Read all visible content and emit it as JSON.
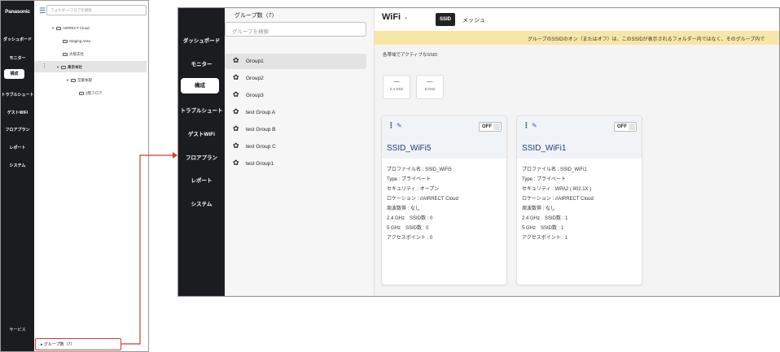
{
  "left_panel": {
    "brand": "Panasonic",
    "nav": [
      "ダッシュボード",
      "モニター",
      "構成",
      "トラブルシュート",
      "ゲストWiFi",
      "フロアプラン",
      "レポート",
      "システム"
    ],
    "active_nav": "構成",
    "search_placeholder": "フォルダー/フロアを検索",
    "tree": [
      {
        "label": "AIRRECT Cloud",
        "level": 0
      },
      {
        "label": "Staging Area",
        "level": 1
      },
      {
        "label": "大阪支社",
        "level": 1
      },
      {
        "label": "東京本社",
        "level": 1,
        "selected": true
      },
      {
        "label": "営業本部",
        "level": 2
      },
      {
        "label": "1階フロア",
        "level": 3
      }
    ],
    "service": "サービス",
    "group_count_label": "グループ数（7）"
  },
  "right_panel": {
    "nav": [
      "ダッシュボード",
      "モニター",
      "構成",
      "トラブルシュート",
      "ゲストWiFi",
      "フロアプラン",
      "レポート",
      "システム"
    ],
    "active_nav": "構成",
    "groups_title": "グループ数（7）",
    "groups_search_placeholder": "グループを検索",
    "groups": [
      "Group1",
      "Group2",
      "Group3",
      "test Group A",
      "test Group B",
      "test Group C",
      "test Group1"
    ],
    "selected_group": "Group1",
    "wifi_title": "WiFi",
    "tabs": [
      "SSID",
      "メッシュ"
    ],
    "active_tab": "SSID",
    "banner": "グループのSSIDのオン（またはオフ）は、このSSIDが表示されるフォルダー内ではなく、そのグループ内で",
    "active_ssid_label": "各帯域でアクティブなSSID",
    "bands": [
      {
        "value": "—",
        "label": "2.4 GHz"
      },
      {
        "value": "—",
        "label": "5 GHz"
      }
    ],
    "cards": [
      {
        "title": "SSID_WiFi5",
        "toggle": "OFF",
        "props": [
          "プロファイル名 : SSID_WiFi5",
          "Type : プライベート",
          "セキュリティ : オープン",
          "ロケーション : //AIRRECT Cloud",
          "周波数帯 : なし",
          "2.4 GHz　SSID数 : 0",
          "5 GHz　SSID数 : 0",
          "アクセスポイント : 0"
        ]
      },
      {
        "title": "SSID_WiFi1",
        "toggle": "OFF",
        "props": [
          "プロファイル名 : SSID_WiFi1",
          "Type : プライベート",
          "セキュリティ : WPA2 ( 802.1X )",
          "ロケーション : //AIRRECT Cloud",
          "周波数帯 : なし",
          "2.4 GHz　SSID数 : 1",
          "5 GHz　SSID数 : 1",
          "アクセスポイント : 1"
        ]
      }
    ]
  },
  "colors": {
    "nav_bg": "#1b1c20",
    "accent_blue": "#1d3f7d",
    "banner_bg": "#f8e6a7",
    "highlight_red": "#d43b30"
  }
}
